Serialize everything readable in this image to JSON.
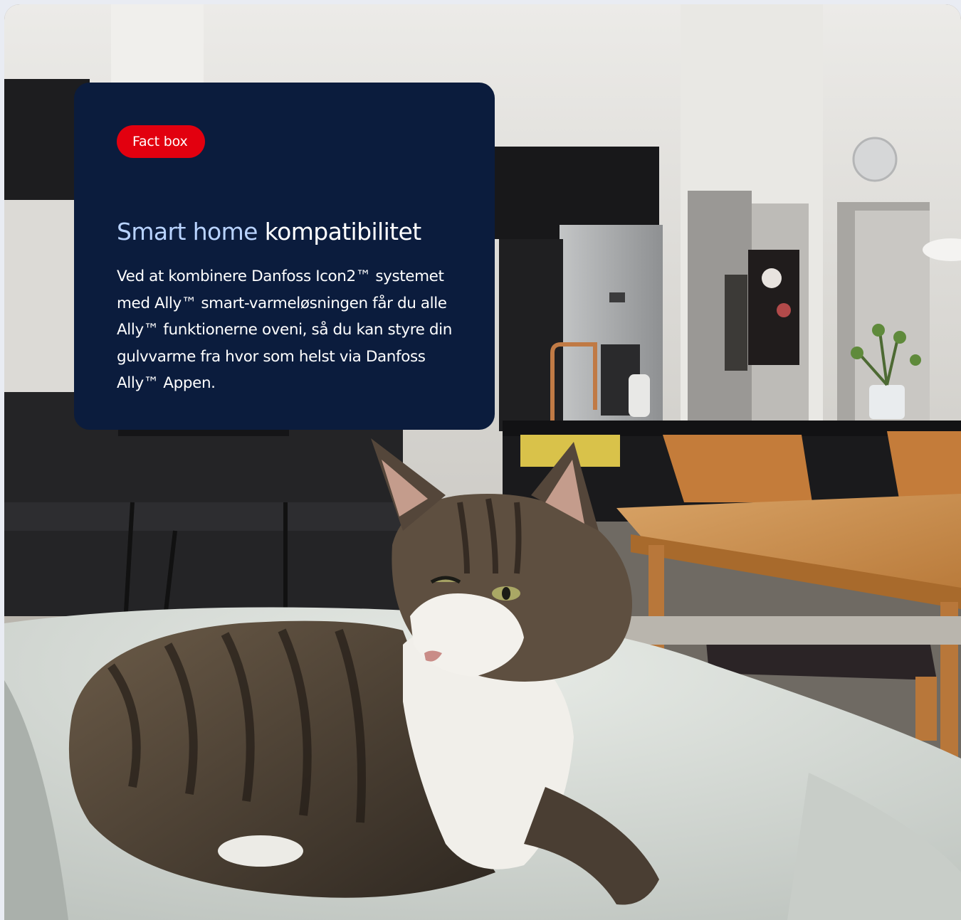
{
  "fact_box": {
    "badge_label": "Fact box",
    "title_highlight": "Smart home",
    "title_rest": "kompatibilitet",
    "body": "Ved at kombinere Danfoss Icon2™ systemet med Ally™ smart-varmeløsningen får du alle Ally™ funktionerne oveni, så du kan styre din gulvvarme fra hvor som helst via Danfoss Ally™ Appen."
  },
  "background_photo": {
    "subject": "tabby-cat-on-pet-bed-in-kitchen",
    "colors": {
      "wall": "#e4e2de",
      "cabinet": "#1c1c1e",
      "table": "#c98b45",
      "bed": "#d9ddd8",
      "cat_dark": "#3a322a",
      "cat_white": "#f2f0ec",
      "card": "#0b1c3d",
      "badge": "#e2000f",
      "highlight": "#b9d3ff"
    }
  }
}
